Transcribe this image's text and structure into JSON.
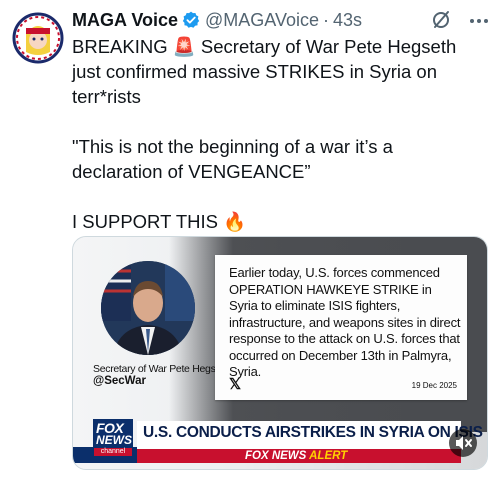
{
  "author": {
    "name": "MAGA Voice",
    "handle": "@MAGAVoice",
    "separator": "·",
    "time": "43s"
  },
  "post": {
    "line1": "BREAKING 🚨 Secretary of War Pete Hegseth",
    "line2": "just confirmed massive STRIKES in Syria on",
    "line3": "terr*rists",
    "line4": "\"This is not the beginning of a war it’s a",
    "line5": "declaration of VENGEANCE”",
    "line6": "I SUPPORT THIS 🔥"
  },
  "media": {
    "caption_name": "Secretary of War Pete Hegseth",
    "caption_handle": "@SecWar",
    "quote_text": "Earlier today, U.S. forces commenced OPERATION HAWKEYE STRIKE in Syria to eliminate ISIS fighters, infrastructure, and weapons sites in direct response to the attack on U.S. forces that occurred on December 13th in Palmyra, Syria.",
    "x_logo": "𝕏",
    "quote_date": "19 Dec 2025",
    "fox_line1": "FOX",
    "fox_line2": "NEWS",
    "fox_line3": "channel",
    "headline": "U.S. CONDUCTS AIRSTRIKES IN SYRIA ON ISIS",
    "alert_prefix": "FOX NEWS",
    "alert_word": "ALERT"
  },
  "icons": {
    "verified": "verified-badge-icon",
    "grok": "grok-icon",
    "more": "more-options-icon",
    "mute": "mute-icon"
  },
  "colors": {
    "verified": "#1d9bf0",
    "fox_blue": "#0b2f6b",
    "fox_red": "#c8102e",
    "alert_yellow": "#ffd200"
  }
}
